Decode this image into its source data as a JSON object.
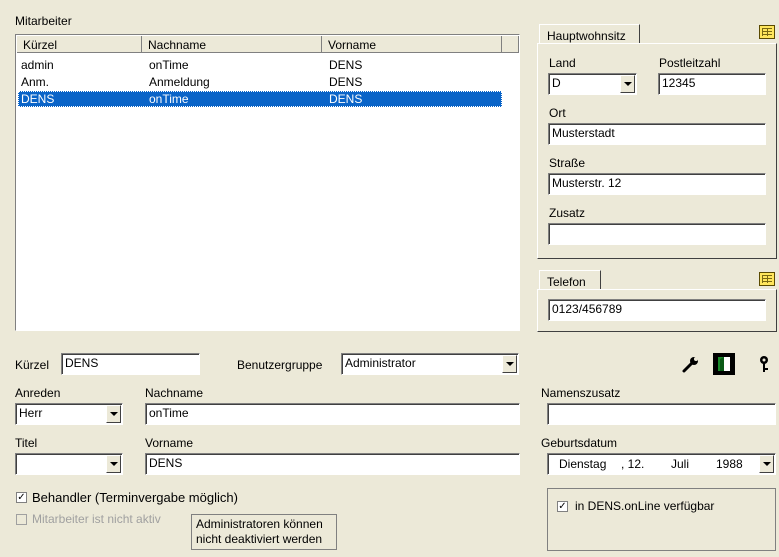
{
  "employees": {
    "title": "Mitarbeiter",
    "columns": [
      "Kürzel",
      "Nachname",
      "Vorname"
    ],
    "rows": [
      {
        "kuerzel": "admin",
        "nachname": "onTime",
        "vorname": "DENS"
      },
      {
        "kuerzel": "Anm.",
        "nachname": "Anmeldung",
        "vorname": "DENS"
      },
      {
        "kuerzel": "DENS",
        "nachname": "onTime",
        "vorname": "DENS"
      }
    ],
    "selected_index": 2
  },
  "address": {
    "tab": "Hauptwohnsitz",
    "land_label": "Land",
    "land_value": "D",
    "plz_label": "Postleitzahl",
    "plz_value": "12345",
    "ort_label": "Ort",
    "ort_value": "Musterstadt",
    "strasse_label": "Straße",
    "strasse_value": "Musterstr. 12",
    "zusatz_label": "Zusatz",
    "zusatz_value": ""
  },
  "phone": {
    "tab": "Telefon",
    "value": "0123/456789"
  },
  "form": {
    "kuerzel_label": "Kürzel",
    "kuerzel_value": "DENS",
    "gruppe_label": "Benutzergruppe",
    "gruppe_value": "Administrator",
    "anreden_label": "Anreden",
    "anreden_value": "Herr",
    "nachname_label": "Nachname",
    "nachname_value": "onTime",
    "namenszusatz_label": "Namenszusatz",
    "namenszusatz_value": "",
    "titel_label": "Titel",
    "titel_value": "",
    "vorname_label": "Vorname",
    "vorname_value": "DENS",
    "geburtsdatum_label": "Geburtsdatum",
    "geb_weekday": "Dienstag",
    "geb_day": ", 12.",
    "geb_month": "Juli",
    "geb_year": "1988",
    "behandler_label": "Behandler (Terminvergabe möglich)",
    "behandler_checked": true,
    "inaktiv_label": "Mitarbeiter ist nicht aktiv",
    "inaktiv_checked": false,
    "admin_note_line1": "Administratoren können",
    "admin_note_line2": "nicht deaktiviert werden",
    "online_label": "in DENS.onLine verfügbar",
    "online_checked": true
  },
  "icons": [
    "grid-icon",
    "wrench-icon",
    "door-exit-icon",
    "key-icon"
  ]
}
